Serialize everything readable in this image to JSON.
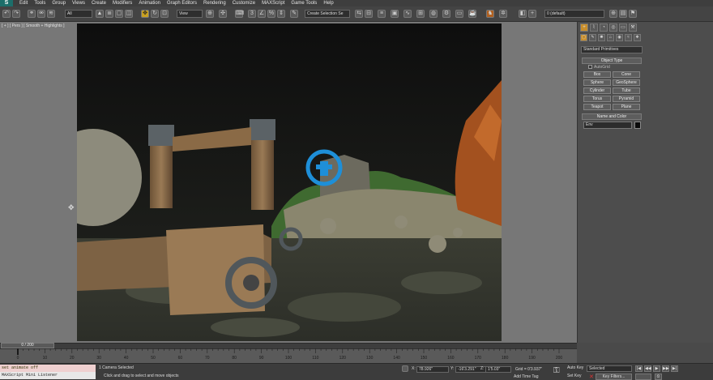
{
  "menubar": {
    "logo": "S",
    "items": [
      "Edit",
      "Tools",
      "Group",
      "Views",
      "Create",
      "Modifiers",
      "Animation",
      "Graph Editors",
      "Rendering",
      "Customize",
      "MAXScript",
      "Game Tools",
      "Help"
    ]
  },
  "toolbar": {
    "selection_filter": "All",
    "reference_coord": "View",
    "named_selection": "Create Selection Se",
    "layer_select": "0 (default)"
  },
  "viewport": {
    "label": "[ + ] [ Pers ] [ Smooth + Highlights ]"
  },
  "command_panel": {
    "tabs": [
      "+",
      "⌇",
      "◔",
      "◎",
      "▭",
      "⚒"
    ],
    "sub_icons": [
      "◯",
      "✎",
      "✺",
      "⌂",
      "◉",
      "≈",
      "❖"
    ],
    "category": "Standard Primitives",
    "object_type_header": "Object Type",
    "autogrid_label": "AutoGrid",
    "object_buttons": [
      "Box",
      "Cone",
      "Sphere",
      "GeoSphere",
      "Cylinder",
      "Tube",
      "Torus",
      "Pyramid",
      "Teapot",
      "Plane"
    ],
    "name_color_header": "Name and Color",
    "name_value": "Env"
  },
  "timeline": {
    "thumb": "0 / 200",
    "ticks": [
      "0",
      "10",
      "20",
      "30",
      "40",
      "50",
      "60",
      "70",
      "80",
      "90",
      "100",
      "110",
      "120",
      "130",
      "140",
      "150",
      "160",
      "170",
      "180",
      "190",
      "200"
    ],
    "range_start": 0,
    "range_end": 200,
    "current_frame": 0
  },
  "status": {
    "maxscript_input": "set animate off",
    "maxscript_output": "MAXScript Mini Listener",
    "selection_info": "1 Camera Selected",
    "prompt": "Click and drag to select and move objects",
    "x_label": "X:",
    "x_value": "78.926\"",
    "y_label": "Y:",
    "y_value": "-16'3.291\"",
    "z_label": "Z:",
    "z_value": "1'5.03\"",
    "grid": "Grid = 0'3.937\"",
    "add_time_tag": "Add Time Tag",
    "auto_key": "Auto Key",
    "set_key": "Set Key",
    "key_mode": "Selected",
    "key_filters": "Key Filters...",
    "playback_buttons": [
      "|◀",
      "◀◀",
      "▶",
      "▶▶",
      "▶|"
    ]
  },
  "colors": {
    "logo_bg": "#1c6e6a",
    "viewport_sky": "#121212",
    "move_gizmo": "#1e8fd8",
    "maxscript_input_bg": "#efd0d0"
  }
}
